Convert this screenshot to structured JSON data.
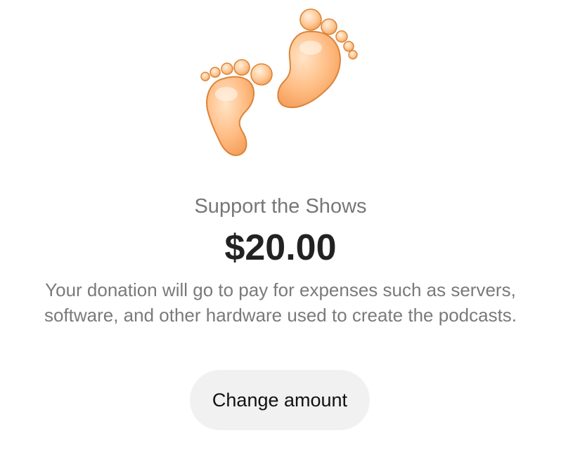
{
  "support": {
    "logo_icon": "footprints-icon",
    "title": "Support the Shows",
    "amount": "$20.00",
    "description": "Your donation will go to pay for expenses such as servers, software, and other hardware used to create the podcasts.",
    "change_amount_label": "Change amount"
  },
  "colors": {
    "foot": "#ffb879",
    "foot_outline": "#e2893f",
    "button_bg": "#f1f1f1"
  }
}
